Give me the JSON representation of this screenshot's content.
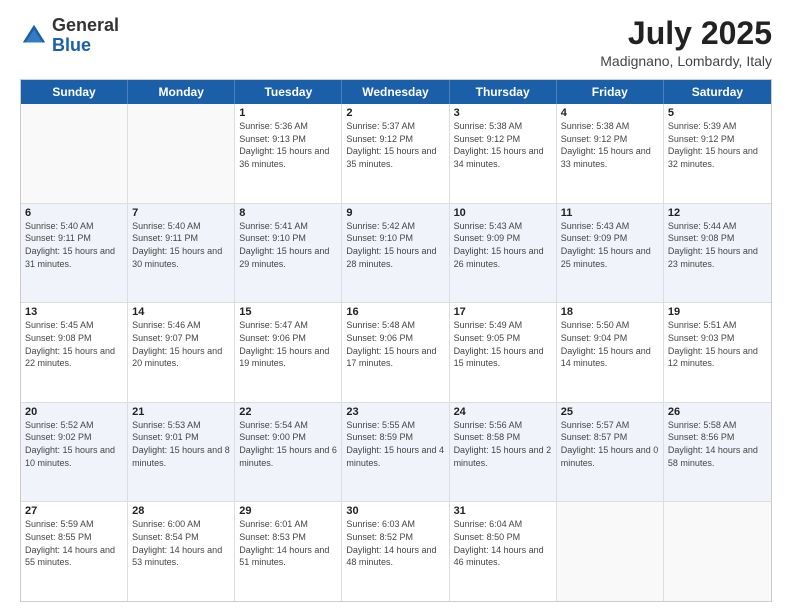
{
  "header": {
    "logo_general": "General",
    "logo_blue": "Blue",
    "month_year": "July 2025",
    "location": "Madignano, Lombardy, Italy"
  },
  "calendar": {
    "days": [
      "Sunday",
      "Monday",
      "Tuesday",
      "Wednesday",
      "Thursday",
      "Friday",
      "Saturday"
    ],
    "rows": [
      [
        {
          "day": "",
          "info": ""
        },
        {
          "day": "",
          "info": ""
        },
        {
          "day": "1",
          "info": "Sunrise: 5:36 AM\nSunset: 9:13 PM\nDaylight: 15 hours and 36 minutes."
        },
        {
          "day": "2",
          "info": "Sunrise: 5:37 AM\nSunset: 9:12 PM\nDaylight: 15 hours and 35 minutes."
        },
        {
          "day": "3",
          "info": "Sunrise: 5:38 AM\nSunset: 9:12 PM\nDaylight: 15 hours and 34 minutes."
        },
        {
          "day": "4",
          "info": "Sunrise: 5:38 AM\nSunset: 9:12 PM\nDaylight: 15 hours and 33 minutes."
        },
        {
          "day": "5",
          "info": "Sunrise: 5:39 AM\nSunset: 9:12 PM\nDaylight: 15 hours and 32 minutes."
        }
      ],
      [
        {
          "day": "6",
          "info": "Sunrise: 5:40 AM\nSunset: 9:11 PM\nDaylight: 15 hours and 31 minutes."
        },
        {
          "day": "7",
          "info": "Sunrise: 5:40 AM\nSunset: 9:11 PM\nDaylight: 15 hours and 30 minutes."
        },
        {
          "day": "8",
          "info": "Sunrise: 5:41 AM\nSunset: 9:10 PM\nDaylight: 15 hours and 29 minutes."
        },
        {
          "day": "9",
          "info": "Sunrise: 5:42 AM\nSunset: 9:10 PM\nDaylight: 15 hours and 28 minutes."
        },
        {
          "day": "10",
          "info": "Sunrise: 5:43 AM\nSunset: 9:09 PM\nDaylight: 15 hours and 26 minutes."
        },
        {
          "day": "11",
          "info": "Sunrise: 5:43 AM\nSunset: 9:09 PM\nDaylight: 15 hours and 25 minutes."
        },
        {
          "day": "12",
          "info": "Sunrise: 5:44 AM\nSunset: 9:08 PM\nDaylight: 15 hours and 23 minutes."
        }
      ],
      [
        {
          "day": "13",
          "info": "Sunrise: 5:45 AM\nSunset: 9:08 PM\nDaylight: 15 hours and 22 minutes."
        },
        {
          "day": "14",
          "info": "Sunrise: 5:46 AM\nSunset: 9:07 PM\nDaylight: 15 hours and 20 minutes."
        },
        {
          "day": "15",
          "info": "Sunrise: 5:47 AM\nSunset: 9:06 PM\nDaylight: 15 hours and 19 minutes."
        },
        {
          "day": "16",
          "info": "Sunrise: 5:48 AM\nSunset: 9:06 PM\nDaylight: 15 hours and 17 minutes."
        },
        {
          "day": "17",
          "info": "Sunrise: 5:49 AM\nSunset: 9:05 PM\nDaylight: 15 hours and 15 minutes."
        },
        {
          "day": "18",
          "info": "Sunrise: 5:50 AM\nSunset: 9:04 PM\nDaylight: 15 hours and 14 minutes."
        },
        {
          "day": "19",
          "info": "Sunrise: 5:51 AM\nSunset: 9:03 PM\nDaylight: 15 hours and 12 minutes."
        }
      ],
      [
        {
          "day": "20",
          "info": "Sunrise: 5:52 AM\nSunset: 9:02 PM\nDaylight: 15 hours and 10 minutes."
        },
        {
          "day": "21",
          "info": "Sunrise: 5:53 AM\nSunset: 9:01 PM\nDaylight: 15 hours and 8 minutes."
        },
        {
          "day": "22",
          "info": "Sunrise: 5:54 AM\nSunset: 9:00 PM\nDaylight: 15 hours and 6 minutes."
        },
        {
          "day": "23",
          "info": "Sunrise: 5:55 AM\nSunset: 8:59 PM\nDaylight: 15 hours and 4 minutes."
        },
        {
          "day": "24",
          "info": "Sunrise: 5:56 AM\nSunset: 8:58 PM\nDaylight: 15 hours and 2 minutes."
        },
        {
          "day": "25",
          "info": "Sunrise: 5:57 AM\nSunset: 8:57 PM\nDaylight: 15 hours and 0 minutes."
        },
        {
          "day": "26",
          "info": "Sunrise: 5:58 AM\nSunset: 8:56 PM\nDaylight: 14 hours and 58 minutes."
        }
      ],
      [
        {
          "day": "27",
          "info": "Sunrise: 5:59 AM\nSunset: 8:55 PM\nDaylight: 14 hours and 55 minutes."
        },
        {
          "day": "28",
          "info": "Sunrise: 6:00 AM\nSunset: 8:54 PM\nDaylight: 14 hours and 53 minutes."
        },
        {
          "day": "29",
          "info": "Sunrise: 6:01 AM\nSunset: 8:53 PM\nDaylight: 14 hours and 51 minutes."
        },
        {
          "day": "30",
          "info": "Sunrise: 6:03 AM\nSunset: 8:52 PM\nDaylight: 14 hours and 48 minutes."
        },
        {
          "day": "31",
          "info": "Sunrise: 6:04 AM\nSunset: 8:50 PM\nDaylight: 14 hours and 46 minutes."
        },
        {
          "day": "",
          "info": ""
        },
        {
          "day": "",
          "info": ""
        }
      ]
    ]
  }
}
